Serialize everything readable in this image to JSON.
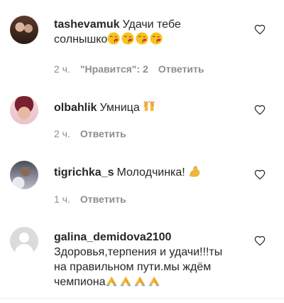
{
  "comments": [
    {
      "username": "tashevamuk",
      "text_line1": "Удачи тебе",
      "text_line2": "солнышко",
      "emojis": [
        "kiss-face",
        "kiss-face",
        "kiss-face",
        "kiss-face"
      ],
      "time": "2 ч.",
      "likes": "\"Нравится\": 2",
      "reply": "Ответить"
    },
    {
      "username": "olbahlik",
      "text": "Умница",
      "emojis": [
        "raising-hands"
      ],
      "time": "2 ч.",
      "reply": "Ответить"
    },
    {
      "username": "tigrichka_s",
      "text": "Молодчинка!",
      "emojis": [
        "flexed-biceps"
      ],
      "time": "1 ч.",
      "reply": "Ответить"
    },
    {
      "username": "galina_demidova2100",
      "text_line1": "Здоровья,терпения и удачи!!!ты",
      "text_line2": "на правильном пути.мы ждём",
      "text_line3": "чемпиона",
      "emojis": [
        "folded-hands",
        "folded-hands",
        "folded-hands",
        "folded-hands"
      ]
    }
  ],
  "colors": {
    "text": "#262626",
    "meta": "#8e8e8e",
    "separator": "#efefef"
  }
}
